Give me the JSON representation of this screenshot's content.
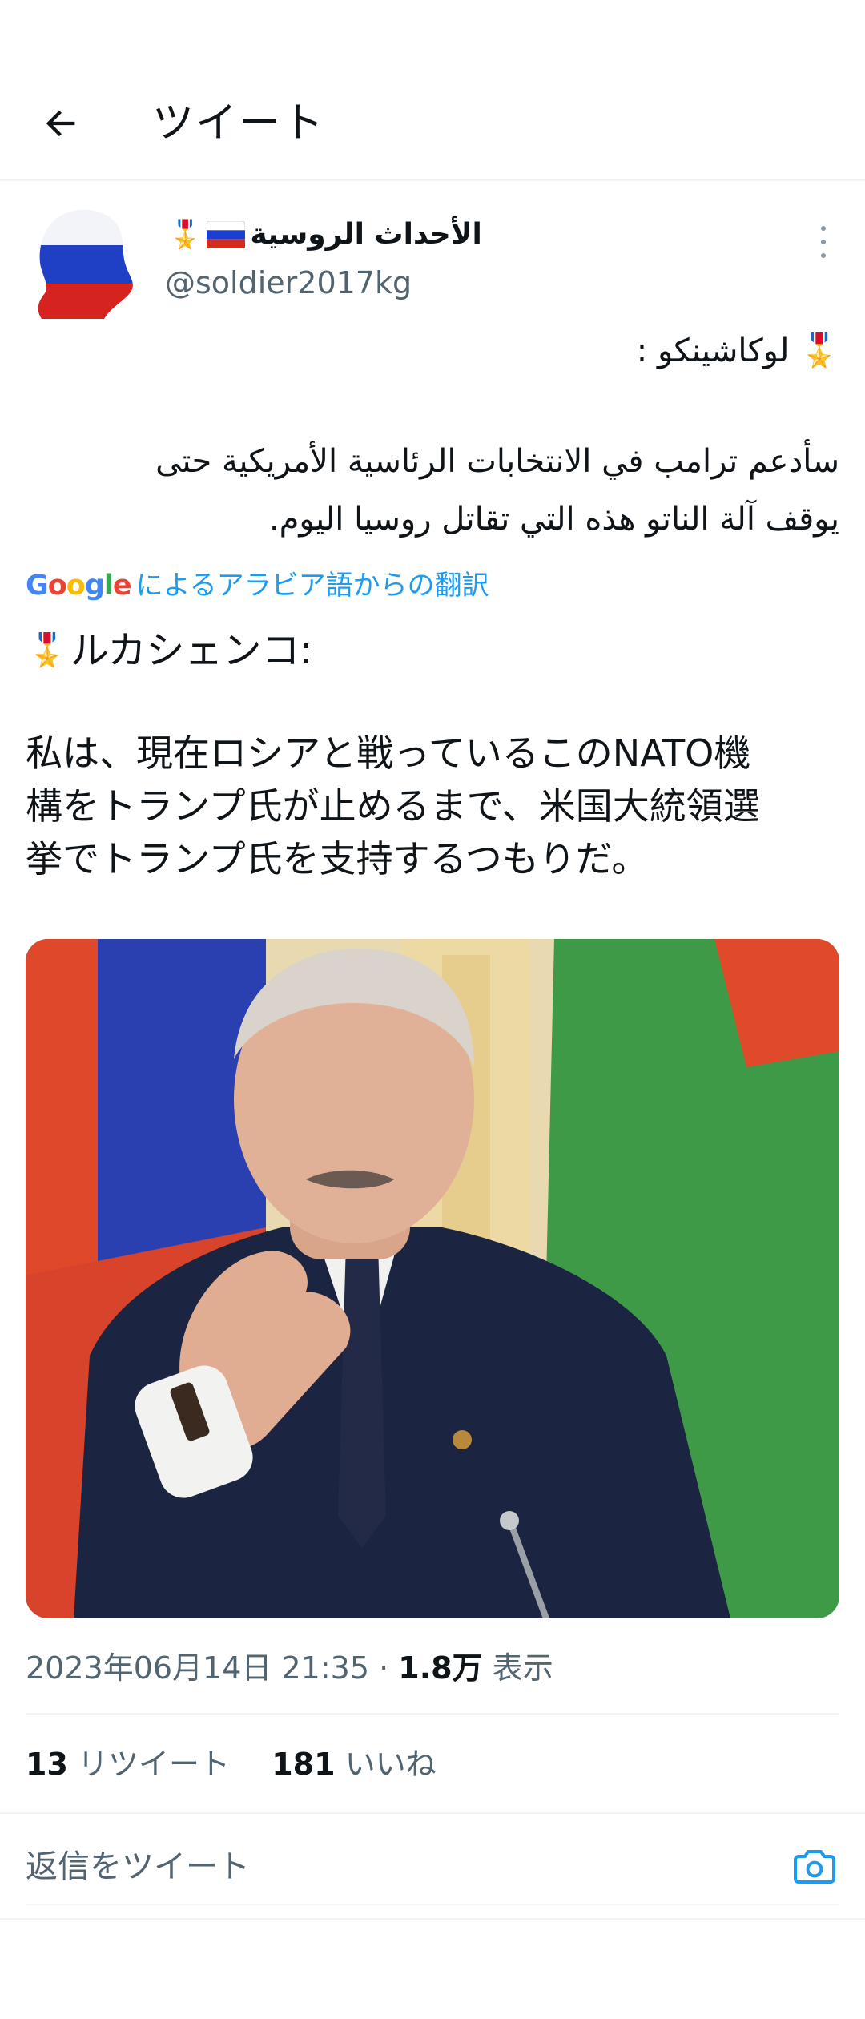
{
  "header": {
    "title": "ツイート"
  },
  "tweet": {
    "author": {
      "display_name": "الأحداث الروسية",
      "handle": "@soldier2017kg"
    },
    "original_lines": [
      "🎖️ لوكاشينكو :",
      "سأدعم ترامب في الانتخابات الرئاسية الأمريكية حتى",
      "يوقف آلة الناتو هذه التي تقاتل روسيا اليوم."
    ],
    "translation_label": "によるアラビア語からの翻訳",
    "translation_brand": "Google",
    "translation_heading": "ルカシェンコ:",
    "translation_lines": [
      "私は、現在ロシアと戦っているこのNATO機",
      "構をトランプ氏が止めるまで、米国大統領選",
      "挙でトランプ氏を支持するつもりだ。"
    ],
    "timestamp": "2023年06月14日 21:35",
    "views_count": "1.8万",
    "views_label": "表示",
    "retweets_count": "13",
    "retweets_label": "リツイート",
    "likes_count": "181",
    "likes_label": "いいね"
  },
  "reply": {
    "placeholder": "返信をツイート"
  },
  "icons": {
    "back": "arrow-left-icon",
    "more": "more-vertical-icon",
    "medal": "medal-icon",
    "flag": "russia-flag-icon",
    "camera": "camera-icon"
  },
  "colors": {
    "accent": "#1d9bf0",
    "secondary_text": "#536471",
    "divider": "#eff3f4"
  }
}
